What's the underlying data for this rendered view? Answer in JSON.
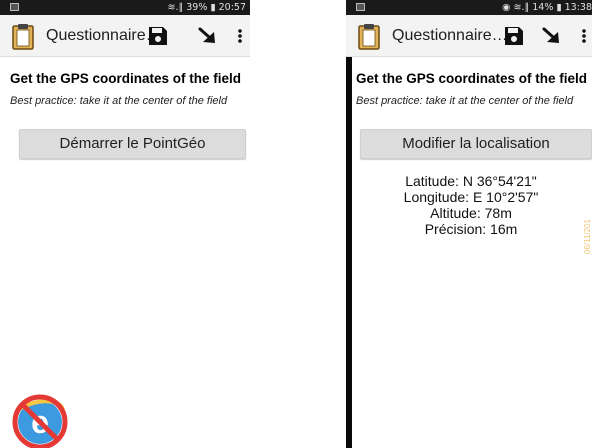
{
  "left_screen": {
    "status": {
      "text": "≋.∥ 39% ▮ 20:57"
    },
    "toolbar": {
      "title": "Questionnaire…",
      "icons": [
        "clipboard-icon",
        "save-icon",
        "navigate-icon",
        "overflow-menu-icon"
      ]
    },
    "question": "Get the GPS coordinates of the field",
    "hint": "Best practice: take it at the center of the field",
    "action_button": "Démarrer le PointGéo",
    "overlay_icon": "no-internet-explorer-icon"
  },
  "right_screen": {
    "status": {
      "text": "◉ ≋.∥ 14% ▮ 13:38"
    },
    "toolbar": {
      "title": "Questionnaire…",
      "icons": [
        "clipboard-icon",
        "save-icon",
        "navigate-icon",
        "overflow-menu-icon"
      ]
    },
    "question": "Get the GPS coordinates of the field",
    "hint": "Best practice: take it at the center of the field",
    "action_button": "Modifier la localisation",
    "gps": {
      "latitude": "Latitude: N 36°54'21\"",
      "longitude": "Longitude: E 10°2'57\"",
      "altitude": "Altitude: 78m",
      "precision": "Précision: 16m"
    },
    "watermark": "06/11/201"
  },
  "colors": {
    "status_bar": "#1a1a1a",
    "toolbar": "#f3f3f3",
    "button": "#dcdcdc",
    "clipboard": "#e2b45a"
  }
}
